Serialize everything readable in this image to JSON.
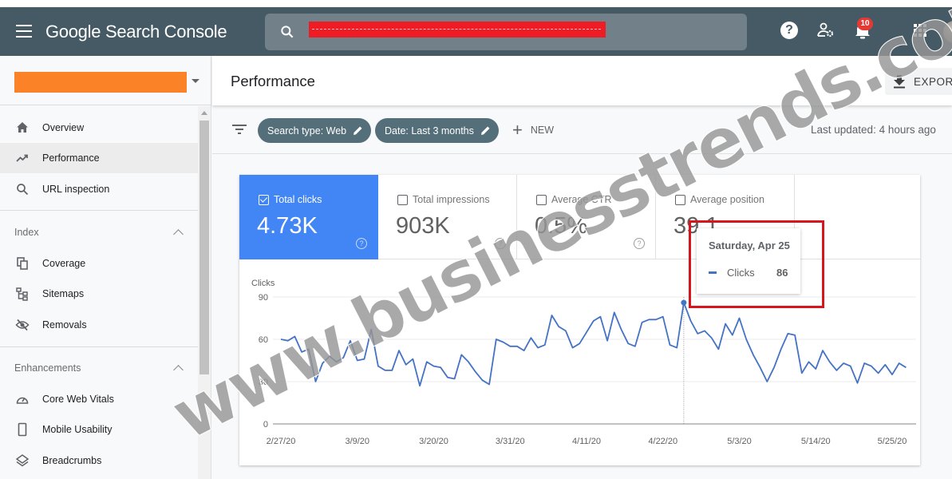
{
  "app": {
    "title": "Google Search Console",
    "logo_google": "Google",
    "logo_product": "Search Console",
    "notification_count": "10"
  },
  "search": {
    "value": "[redacted]",
    "redaction_color": "#ee1c25"
  },
  "header_icons": [
    "help-icon",
    "admin-settings-icon",
    "notifications-bell-icon",
    "apps-grid-icon",
    "account-avatar"
  ],
  "property": {
    "name": "[redacted]",
    "redaction_color": "#fb8227"
  },
  "sidebar": {
    "items": [
      {
        "label": "Overview",
        "icon": "home-icon",
        "active": false
      },
      {
        "label": "Performance",
        "icon": "trending-up-icon",
        "active": true
      },
      {
        "label": "URL inspection",
        "icon": "search-icon",
        "active": false
      }
    ],
    "sections": [
      {
        "label": "Index",
        "items": [
          {
            "label": "Coverage",
            "icon": "coverage-icon"
          },
          {
            "label": "Sitemaps",
            "icon": "sitemap-icon"
          },
          {
            "label": "Removals",
            "icon": "visibility-off-icon"
          }
        ]
      },
      {
        "label": "Enhancements",
        "items": [
          {
            "label": "Core Web Vitals",
            "icon": "speedometer-icon"
          },
          {
            "label": "Mobile Usability",
            "icon": "phone-icon"
          },
          {
            "label": "Breadcrumbs",
            "icon": "layers-icon"
          }
        ]
      }
    ]
  },
  "page": {
    "title": "Performance",
    "export_label": "EXPORT"
  },
  "filters": {
    "chips": [
      {
        "label": "Search type: Web"
      },
      {
        "label": "Date: Last 3 months"
      }
    ],
    "new_label": "NEW",
    "last_updated": "Last updated: 4 hours ago"
  },
  "metrics": [
    {
      "label": "Total clicks",
      "value": "4.73K",
      "checked": true,
      "color": "#4285f4"
    },
    {
      "label": "Total impressions",
      "value": "903K",
      "checked": false
    },
    {
      "label": "Average CTR",
      "value": "0.5%",
      "checked": false
    },
    {
      "label": "Average position",
      "value": "39.1",
      "checked": false
    }
  ],
  "tooltip": {
    "date": "Saturday, Apr 25",
    "series": "Clicks",
    "value": "86"
  },
  "watermark": "www.businesstrends.com.pk",
  "chart_data": {
    "type": "line",
    "title": "",
    "ylabel": "Clicks",
    "xlabel": "",
    "ylim": [
      0,
      90
    ],
    "yticks": [
      0,
      30,
      60,
      90
    ],
    "grid": true,
    "x_start": "2/27/20",
    "xtick_labels": [
      "2/27/20",
      "3/9/20",
      "3/20/20",
      "3/31/20",
      "4/11/20",
      "4/22/20",
      "5/3/20",
      "5/14/20",
      "5/25/20"
    ],
    "xtick_day_index": [
      0,
      11,
      22,
      33,
      44,
      55,
      66,
      77,
      88
    ],
    "hover_day_index": 58,
    "series": [
      {
        "name": "Clicks",
        "color": "#4472c4",
        "values": [
          60,
          59,
          62,
          51,
          53,
          30,
          43,
          48,
          44,
          47,
          59,
          45,
          46,
          67,
          41,
          38,
          38,
          52,
          42,
          46,
          27,
          44,
          41,
          40,
          33,
          32,
          49,
          44,
          37,
          31,
          28,
          60,
          58,
          55,
          55,
          52,
          61,
          54,
          56,
          77,
          69,
          66,
          54,
          57,
          65,
          73,
          76,
          59,
          79,
          67,
          57,
          55,
          72,
          74,
          74,
          76,
          56,
          54,
          86,
          73,
          64,
          66,
          61,
          53,
          71,
          63,
          75,
          60,
          49,
          40,
          30,
          40,
          53,
          64,
          63,
          36,
          44,
          39,
          52,
          44,
          38,
          43,
          41,
          29,
          43,
          41,
          36,
          42,
          35,
          43,
          40
        ]
      }
    ]
  }
}
